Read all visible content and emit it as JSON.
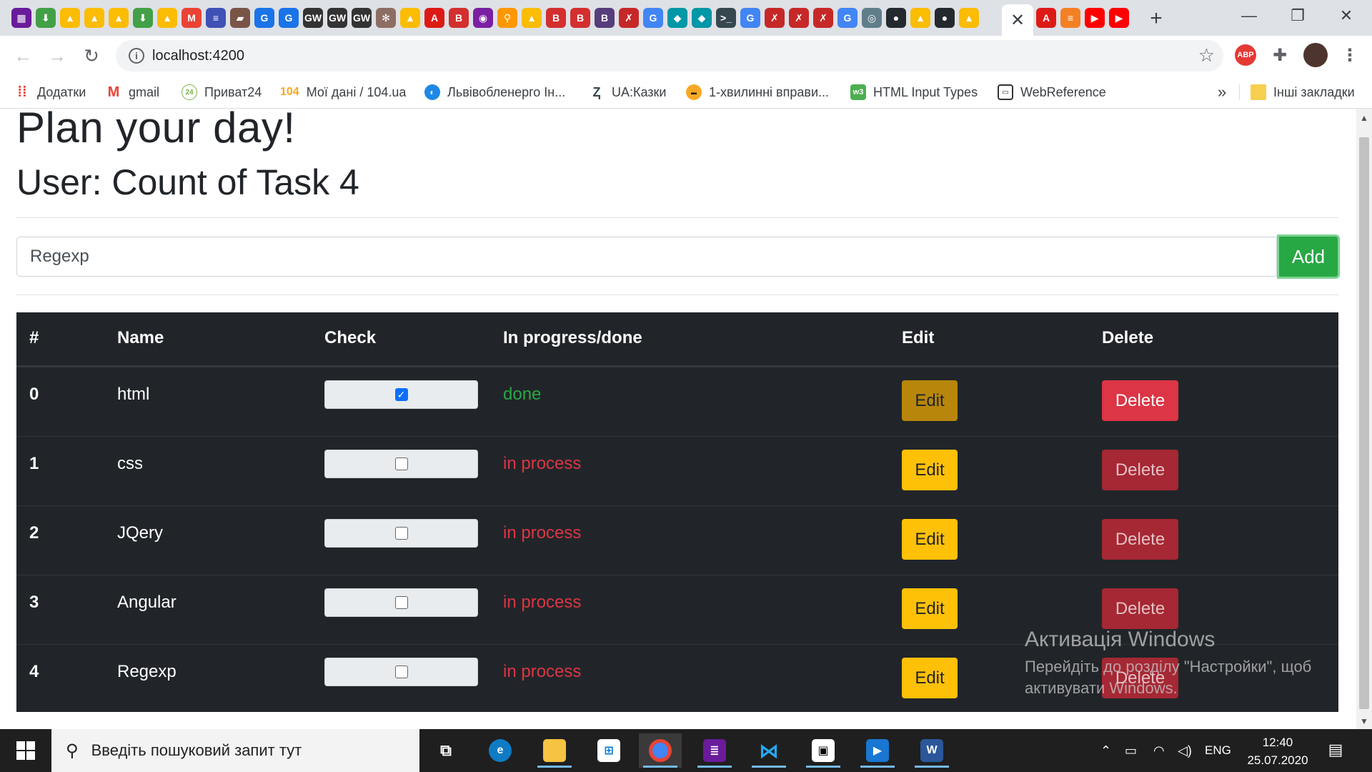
{
  "browser": {
    "url": "localhost:4200",
    "active_tab_close": "✕",
    "new_tab": "+",
    "window_controls": {
      "minimize": "—",
      "restore": "❐",
      "close": "✕"
    },
    "extensions": {
      "adblock": "ABP"
    }
  },
  "bookmarks": [
    {
      "label": "Додатки",
      "icon": "apps-grid-icon"
    },
    {
      "label": "gmail",
      "icon": "gmail-icon"
    },
    {
      "label": "Приват24",
      "icon": "privat24-icon"
    },
    {
      "label": "Мої дані / 104.ua",
      "icon": "104-icon",
      "icon_text": "104"
    },
    {
      "label": "Львівобленерго Ін...",
      "icon": "loe-icon"
    },
    {
      "label": "UA:Казки",
      "icon": "ua-kazky-icon"
    },
    {
      "label": "1-хвилинні вправи...",
      "icon": "exercise-icon"
    },
    {
      "label": "HTML Input Types",
      "icon": "w3-icon"
    },
    {
      "label": "WebReference",
      "icon": "webreference-icon"
    }
  ],
  "bookmarks_overflow": "»",
  "other_bookmarks": "Інші закладки",
  "page": {
    "title": "Plan your day!",
    "subtitle": "User: Count of Task 4",
    "input_value": "Regexp",
    "add_label": "Add"
  },
  "table": {
    "headers": [
      "#",
      "Name",
      "Check",
      "In progress/done",
      "Edit",
      "Delete"
    ],
    "rows": [
      {
        "num": "0",
        "name": "html",
        "checked": true,
        "status": "done",
        "edit": "Edit",
        "delete": "Delete"
      },
      {
        "num": "1",
        "name": "css",
        "checked": false,
        "status": "in process",
        "edit": "Edit",
        "delete": "Delete"
      },
      {
        "num": "2",
        "name": "JQery",
        "checked": false,
        "status": "in process",
        "edit": "Edit",
        "delete": "Delete"
      },
      {
        "num": "3",
        "name": "Angular",
        "checked": false,
        "status": "in process",
        "edit": "Edit",
        "delete": "Delete"
      },
      {
        "num": "4",
        "name": "Regexp",
        "checked": false,
        "status": "in process",
        "edit": "Edit",
        "delete": "Delete"
      }
    ]
  },
  "watermark": {
    "line1": "Активація Windows",
    "line2": "Перейдіть до розділу \"Настройки\", щоб",
    "line3": "активувати Windows."
  },
  "taskbar": {
    "search_placeholder": "Введіть пошуковий запит тут",
    "language": "ENG",
    "time": "12:40",
    "date": "25.07.2020"
  },
  "colors": {
    "success": "#28a745",
    "danger": "#dc3545",
    "warning": "#ffc107",
    "table_dark": "#212529"
  }
}
